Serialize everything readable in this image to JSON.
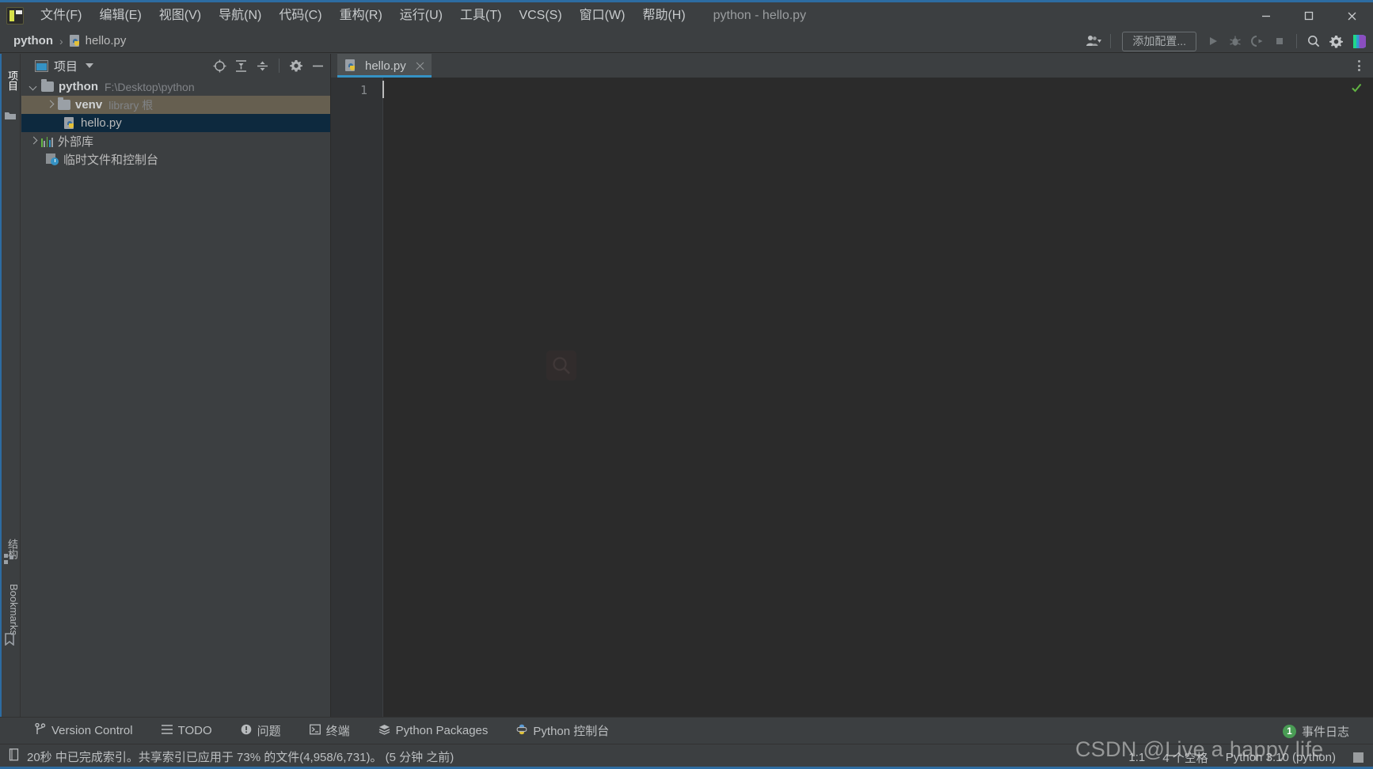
{
  "window": {
    "title": "python - hello.py",
    "controls": {
      "minimize": "minimize-icon",
      "maximize": "maximize-icon",
      "close": "close-icon"
    },
    "accent_color": "#2d6ca2",
    "bg_color": "#3c3f41",
    "editor_bg": "#2b2b2b"
  },
  "menubar": {
    "logo": "pycharm-logo-icon",
    "items": [
      {
        "label": "文件(F)",
        "mnemonic": "F"
      },
      {
        "label": "编辑(E)",
        "mnemonic": "E"
      },
      {
        "label": "视图(V)",
        "mnemonic": "V"
      },
      {
        "label": "导航(N)",
        "mnemonic": "N"
      },
      {
        "label": "代码(C)",
        "mnemonic": "C"
      },
      {
        "label": "重构(R)",
        "mnemonic": "R"
      },
      {
        "label": "运行(U)",
        "mnemonic": "U"
      },
      {
        "label": "工具(T)",
        "mnemonic": "T"
      },
      {
        "label": "VCS(S)",
        "mnemonic": "S"
      },
      {
        "label": "窗口(W)",
        "mnemonic": "W"
      },
      {
        "label": "帮助(H)",
        "mnemonic": "H"
      }
    ]
  },
  "navbar": {
    "breadcrumb": [
      {
        "label": "python",
        "icon": null
      },
      {
        "label": "hello.py",
        "icon": "python-file-icon"
      }
    ],
    "separator": "›",
    "run_config": {
      "label": "添加配置...",
      "placeholder": "添加配置..."
    },
    "icons": {
      "user": "user-account-icon",
      "run": "run-icon",
      "debug": "debug-icon",
      "coverage": "run-with-coverage-icon",
      "stop": "stop-icon",
      "search": "search-everywhere-icon",
      "settings": "settings-gear-icon",
      "updates": "pycharm-pro-icon"
    }
  },
  "left_tool_stripe": {
    "top": [
      {
        "label": "项目",
        "name": "project-tool-window",
        "active": true
      },
      {
        "label": "",
        "name": "commit-tool-window-icon",
        "active": false
      }
    ],
    "bottom": [
      {
        "label": "结构",
        "name": "structure-tool-window",
        "active": false
      },
      {
        "label": "Bookmarks",
        "name": "bookmarks-tool-window",
        "active": false
      }
    ]
  },
  "project_panel": {
    "title": "项目",
    "title_icon": "project-view-icon",
    "header_actions": [
      {
        "name": "select-opened-file-icon"
      },
      {
        "name": "expand-all-icon"
      },
      {
        "name": "collapse-all-icon"
      },
      {
        "name": "settings-gear-icon"
      },
      {
        "name": "hide-panel-icon"
      }
    ],
    "tree": [
      {
        "label": "python",
        "sub": "F:\\Desktop\\python",
        "icon": "folder-icon",
        "twisty": "down",
        "depth": 0,
        "bold": true,
        "state": "none"
      },
      {
        "label": "venv",
        "sub": "library 根",
        "icon": "folder-icon",
        "twisty": "right",
        "depth": 1,
        "bold": true,
        "state": "selected-inactive"
      },
      {
        "label": "hello.py",
        "sub": "",
        "icon": "python-file-icon",
        "twisty": "none",
        "depth": 2,
        "bold": false,
        "state": "selected-active"
      },
      {
        "label": "外部库",
        "sub": "",
        "icon": "external-libraries-icon",
        "twisty": "right",
        "depth": 0,
        "bold": false,
        "state": "none"
      },
      {
        "label": "临时文件和控制台",
        "sub": "",
        "icon": "scratches-and-consoles-icon",
        "twisty": "none",
        "depth": 0,
        "bold": false,
        "state": "none"
      }
    ]
  },
  "editor": {
    "tabs": [
      {
        "label": "hello.py",
        "icon": "python-file-icon",
        "active": true,
        "close": "close-icon"
      }
    ],
    "tab_overflow_icon": "more-options-icon",
    "gutter_line_numbers": [
      "1"
    ],
    "content_lines": [
      ""
    ],
    "inspection_status": "no-problems-ok-icon",
    "background_watermark_icon": "search-everywhere-watermark-icon"
  },
  "tool_window_bar": {
    "items": [
      {
        "label": "Version Control",
        "icon": "version-control-branch-icon"
      },
      {
        "label": "TODO",
        "icon": "todo-list-icon"
      },
      {
        "label": "问题",
        "icon": "problems-icon"
      },
      {
        "label": "终端",
        "icon": "terminal-icon"
      },
      {
        "label": "Python Packages",
        "icon": "python-packages-icon"
      },
      {
        "label": "Python 控制台",
        "icon": "python-console-icon"
      }
    ],
    "right": [
      {
        "label": "事件日志",
        "icon": "event-log-icon",
        "badge": "1",
        "badge_color": "#499c54"
      }
    ]
  },
  "status_bar": {
    "message_icon": "indexing-status-icon",
    "message": "20秒 中已完成索引。共享索引已应用于 73% 的文件(4,958/6,731)。 (5 分钟 之前)",
    "caret_position": "1:1",
    "indent": "4 个空格",
    "interpreter": "Python 3.10 (python)",
    "memory_icon": "file-encoding-block-icon"
  },
  "watermark": {
    "text": "CSDN @Live a happy life"
  }
}
